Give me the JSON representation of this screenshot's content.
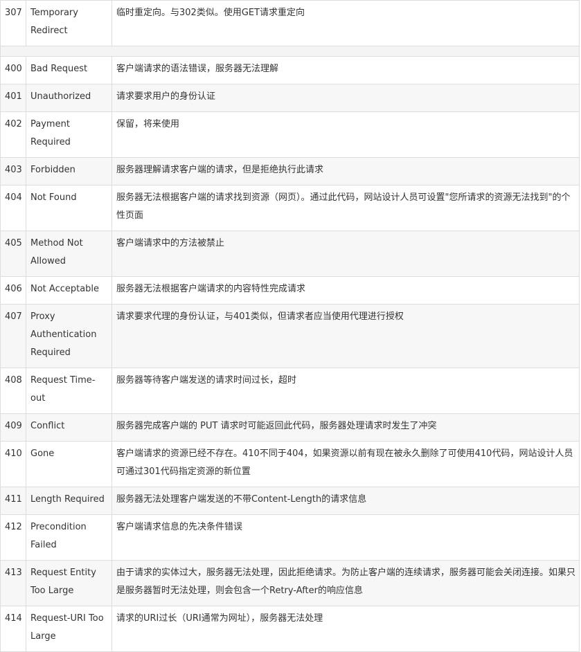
{
  "status_codes": [
    {
      "code": "307",
      "name": "Temporary Redirect",
      "description": "临时重定向。与302类似。使用GET请求重定向"
    },
    {
      "code": "400",
      "name": "Bad Request",
      "description": "客户端请求的语法错误，服务器无法理解"
    },
    {
      "code": "401",
      "name": "Unauthorized",
      "description": "请求要求用户的身份认证"
    },
    {
      "code": "402",
      "name": "Payment Required",
      "description": "保留，将来使用"
    },
    {
      "code": "403",
      "name": "Forbidden",
      "description": "服务器理解请求客户端的请求，但是拒绝执行此请求"
    },
    {
      "code": "404",
      "name": "Not Found",
      "description": "服务器无法根据客户端的请求找到资源（网页）。通过此代码，网站设计人员可设置\"您所请求的资源无法找到\"的个性页面"
    },
    {
      "code": "405",
      "name": "Method Not Allowed",
      "description": "客户端请求中的方法被禁止"
    },
    {
      "code": "406",
      "name": "Not Acceptable",
      "description": "服务器无法根据客户端请求的内容特性完成请求"
    },
    {
      "code": "407",
      "name": "Proxy Authentication Required",
      "description": "请求要求代理的身份认证，与401类似，但请求者应当使用代理进行授权"
    },
    {
      "code": "408",
      "name": "Request Time-out",
      "description": "服务器等待客户端发送的请求时间过长，超时"
    },
    {
      "code": "409",
      "name": "Conflict",
      "description": "服务器完成客户端的 PUT 请求时可能返回此代码，服务器处理请求时发生了冲突"
    },
    {
      "code": "410",
      "name": "Gone",
      "description": "客户端请求的资源已经不存在。410不同于404，如果资源以前有现在被永久删除了可使用410代码，网站设计人员可通过301代码指定资源的新位置"
    },
    {
      "code": "411",
      "name": "Length Required",
      "description": "服务器无法处理客户端发送的不带Content-Length的请求信息"
    },
    {
      "code": "412",
      "name": "Precondition Failed",
      "description": "客户端请求信息的先决条件错误"
    },
    {
      "code": "413",
      "name": "Request Entity Too Large",
      "description": "由于请求的实体过大，服务器无法处理，因此拒绝请求。为防止客户端的连续请求，服务器可能会关闭连接。如果只是服务器暂时无法处理，则会包含一个Retry-After的响应信息"
    },
    {
      "code": "414",
      "name": "Request-URI Too Large",
      "description": "请求的URI过长（URI通常为网址），服务器无法处理"
    }
  ]
}
